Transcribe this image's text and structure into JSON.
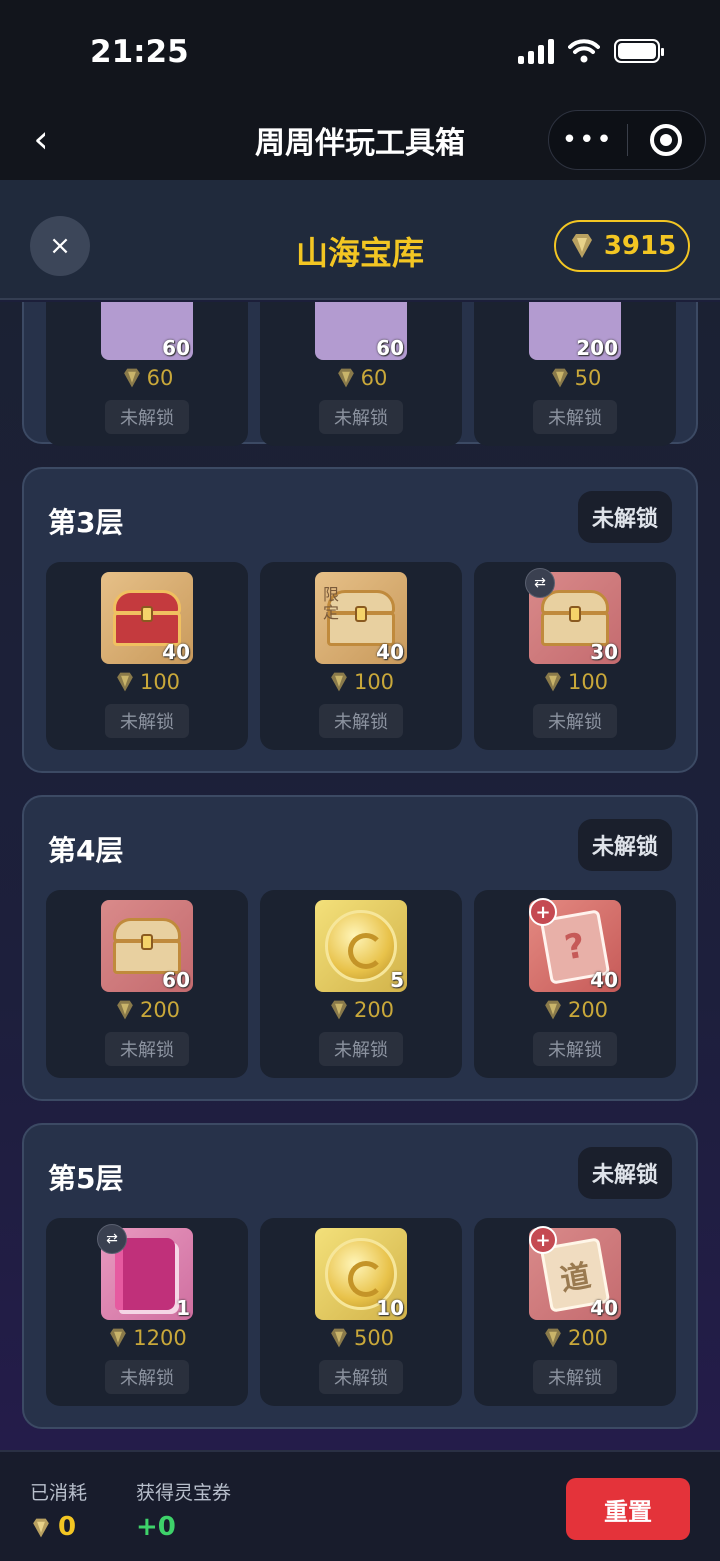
{
  "status": {
    "time": "21:25"
  },
  "nav": {
    "back": "‹",
    "title": "周周伴玩工具箱",
    "more": "•••"
  },
  "header": {
    "close": "×",
    "title": "山海宝库",
    "balance": "3915"
  },
  "layers": [
    {
      "title": "",
      "badge": "",
      "items": [
        {
          "qty": "60",
          "cost": "60",
          "lock": "未解锁"
        },
        {
          "qty": "60",
          "cost": "60",
          "lock": "未解锁"
        },
        {
          "qty": "200",
          "cost": "50",
          "lock": "未解锁"
        }
      ]
    },
    {
      "title": "第3层",
      "badge": "未解锁",
      "items": [
        {
          "icon": "red-chest-icon",
          "qty": "40",
          "cost": "100",
          "lock": "未解锁"
        },
        {
          "icon": "limited-chest-icon",
          "tag": "限定",
          "qty": "40",
          "cost": "100",
          "lock": "未解锁"
        },
        {
          "icon": "gold-chest-icon",
          "qty": "30",
          "cost": "100",
          "lock": "未解锁"
        }
      ]
    },
    {
      "title": "第4层",
      "badge": "未解锁",
      "items": [
        {
          "icon": "gold-chest-icon",
          "qty": "60",
          "cost": "200",
          "lock": "未解锁"
        },
        {
          "icon": "gold-coin-icon",
          "qty": "5",
          "cost": "200",
          "lock": "未解锁"
        },
        {
          "icon": "mystery-card-icon",
          "glyph": "?",
          "qty": "40",
          "cost": "200",
          "lock": "未解锁"
        }
      ]
    },
    {
      "title": "第5层",
      "badge": "未解锁",
      "items": [
        {
          "icon": "pink-book-icon",
          "qty": "1",
          "cost": "1200",
          "lock": "未解锁"
        },
        {
          "icon": "gold-coin-icon",
          "qty": "10",
          "cost": "500",
          "lock": "未解锁"
        },
        {
          "icon": "dao-card-icon",
          "glyph": "道",
          "qty": "40",
          "cost": "200",
          "lock": "未解锁"
        }
      ]
    }
  ],
  "footer": {
    "consumed_label": "已消耗",
    "consumed_value": "0",
    "earned_label": "获得灵宝券",
    "earned_value": "+0",
    "reset": "重置"
  },
  "colors": {
    "accent": "#f3c623",
    "reset": "#e4333a",
    "earned": "#3ed26a"
  }
}
